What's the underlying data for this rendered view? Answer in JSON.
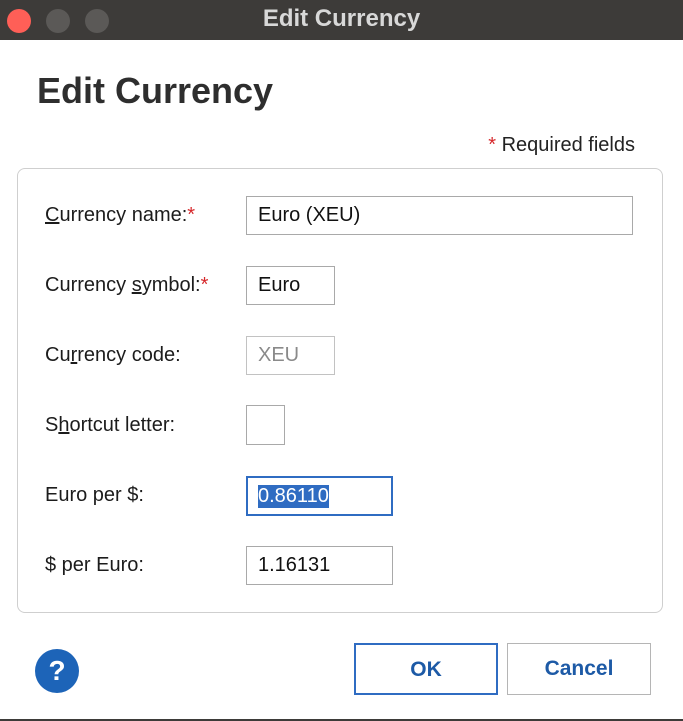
{
  "window": {
    "title": "Edit Currency"
  },
  "header": {
    "title": "Edit Currency",
    "required_star": "*",
    "required_note": "Required fields"
  },
  "form": {
    "currency_name": {
      "label_prefix": "",
      "label_mnemonic": "C",
      "label_rest": "urrency name:",
      "required": "*",
      "value": "Euro (XEU)"
    },
    "currency_symbol": {
      "label_prefix": "Currency ",
      "label_mnemonic": "s",
      "label_rest": "ymbol:",
      "required": "*",
      "value": "Euro"
    },
    "currency_code": {
      "label_prefix": "Cu",
      "label_mnemonic": "r",
      "label_rest": "rency code:",
      "value": "XEU"
    },
    "shortcut_letter": {
      "label_prefix": "S",
      "label_mnemonic": "h",
      "label_rest": "ortcut letter:",
      "value": ""
    },
    "euro_per_dollar": {
      "label": "Euro per $:",
      "value": "0.86110"
    },
    "dollar_per_euro": {
      "label": "$ per Euro:",
      "value": "1.16131"
    }
  },
  "footer": {
    "help_icon": "?",
    "ok_label": "OK",
    "cancel_label": "Cancel"
  }
}
